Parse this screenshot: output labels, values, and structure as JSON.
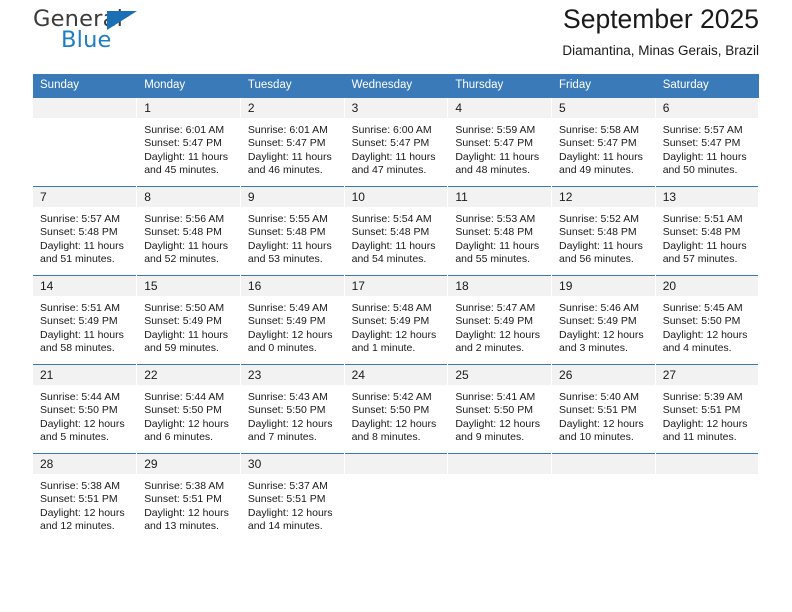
{
  "logo": {
    "word_top": "General",
    "word_bottom": "Blue",
    "triangle": "triangle-icon",
    "color_blue": "#1c7fc4",
    "color_dark": "#3c3c3c"
  },
  "header": {
    "title": "September 2025",
    "subtitle": "Diamantina, Minas Gerais, Brazil",
    "accent_color": "#3a7ab8"
  },
  "weekday_headers": [
    "Sunday",
    "Monday",
    "Tuesday",
    "Wednesday",
    "Thursday",
    "Friday",
    "Saturday"
  ],
  "weeks": [
    [
      {
        "day": "",
        "lines": []
      },
      {
        "day": "1",
        "lines": [
          "Sunrise: 6:01 AM",
          "Sunset: 5:47 PM",
          "Daylight: 11 hours",
          "and 45 minutes."
        ]
      },
      {
        "day": "2",
        "lines": [
          "Sunrise: 6:01 AM",
          "Sunset: 5:47 PM",
          "Daylight: 11 hours",
          "and 46 minutes."
        ]
      },
      {
        "day": "3",
        "lines": [
          "Sunrise: 6:00 AM",
          "Sunset: 5:47 PM",
          "Daylight: 11 hours",
          "and 47 minutes."
        ]
      },
      {
        "day": "4",
        "lines": [
          "Sunrise: 5:59 AM",
          "Sunset: 5:47 PM",
          "Daylight: 11 hours",
          "and 48 minutes."
        ]
      },
      {
        "day": "5",
        "lines": [
          "Sunrise: 5:58 AM",
          "Sunset: 5:47 PM",
          "Daylight: 11 hours",
          "and 49 minutes."
        ]
      },
      {
        "day": "6",
        "lines": [
          "Sunrise: 5:57 AM",
          "Sunset: 5:47 PM",
          "Daylight: 11 hours",
          "and 50 minutes."
        ]
      }
    ],
    [
      {
        "day": "7",
        "lines": [
          "Sunrise: 5:57 AM",
          "Sunset: 5:48 PM",
          "Daylight: 11 hours",
          "and 51 minutes."
        ]
      },
      {
        "day": "8",
        "lines": [
          "Sunrise: 5:56 AM",
          "Sunset: 5:48 PM",
          "Daylight: 11 hours",
          "and 52 minutes."
        ]
      },
      {
        "day": "9",
        "lines": [
          "Sunrise: 5:55 AM",
          "Sunset: 5:48 PM",
          "Daylight: 11 hours",
          "and 53 minutes."
        ]
      },
      {
        "day": "10",
        "lines": [
          "Sunrise: 5:54 AM",
          "Sunset: 5:48 PM",
          "Daylight: 11 hours",
          "and 54 minutes."
        ]
      },
      {
        "day": "11",
        "lines": [
          "Sunrise: 5:53 AM",
          "Sunset: 5:48 PM",
          "Daylight: 11 hours",
          "and 55 minutes."
        ]
      },
      {
        "day": "12",
        "lines": [
          "Sunrise: 5:52 AM",
          "Sunset: 5:48 PM",
          "Daylight: 11 hours",
          "and 56 minutes."
        ]
      },
      {
        "day": "13",
        "lines": [
          "Sunrise: 5:51 AM",
          "Sunset: 5:48 PM",
          "Daylight: 11 hours",
          "and 57 minutes."
        ]
      }
    ],
    [
      {
        "day": "14",
        "lines": [
          "Sunrise: 5:51 AM",
          "Sunset: 5:49 PM",
          "Daylight: 11 hours",
          "and 58 minutes."
        ]
      },
      {
        "day": "15",
        "lines": [
          "Sunrise: 5:50 AM",
          "Sunset: 5:49 PM",
          "Daylight: 11 hours",
          "and 59 minutes."
        ]
      },
      {
        "day": "16",
        "lines": [
          "Sunrise: 5:49 AM",
          "Sunset: 5:49 PM",
          "Daylight: 12 hours",
          "and 0 minutes."
        ]
      },
      {
        "day": "17",
        "lines": [
          "Sunrise: 5:48 AM",
          "Sunset: 5:49 PM",
          "Daylight: 12 hours",
          "and 1 minute."
        ]
      },
      {
        "day": "18",
        "lines": [
          "Sunrise: 5:47 AM",
          "Sunset: 5:49 PM",
          "Daylight: 12 hours",
          "and 2 minutes."
        ]
      },
      {
        "day": "19",
        "lines": [
          "Sunrise: 5:46 AM",
          "Sunset: 5:49 PM",
          "Daylight: 12 hours",
          "and 3 minutes."
        ]
      },
      {
        "day": "20",
        "lines": [
          "Sunrise: 5:45 AM",
          "Sunset: 5:50 PM",
          "Daylight: 12 hours",
          "and 4 minutes."
        ]
      }
    ],
    [
      {
        "day": "21",
        "lines": [
          "Sunrise: 5:44 AM",
          "Sunset: 5:50 PM",
          "Daylight: 12 hours",
          "and 5 minutes."
        ]
      },
      {
        "day": "22",
        "lines": [
          "Sunrise: 5:44 AM",
          "Sunset: 5:50 PM",
          "Daylight: 12 hours",
          "and 6 minutes."
        ]
      },
      {
        "day": "23",
        "lines": [
          "Sunrise: 5:43 AM",
          "Sunset: 5:50 PM",
          "Daylight: 12 hours",
          "and 7 minutes."
        ]
      },
      {
        "day": "24",
        "lines": [
          "Sunrise: 5:42 AM",
          "Sunset: 5:50 PM",
          "Daylight: 12 hours",
          "and 8 minutes."
        ]
      },
      {
        "day": "25",
        "lines": [
          "Sunrise: 5:41 AM",
          "Sunset: 5:50 PM",
          "Daylight: 12 hours",
          "and 9 minutes."
        ]
      },
      {
        "day": "26",
        "lines": [
          "Sunrise: 5:40 AM",
          "Sunset: 5:51 PM",
          "Daylight: 12 hours",
          "and 10 minutes."
        ]
      },
      {
        "day": "27",
        "lines": [
          "Sunrise: 5:39 AM",
          "Sunset: 5:51 PM",
          "Daylight: 12 hours",
          "and 11 minutes."
        ]
      }
    ],
    [
      {
        "day": "28",
        "lines": [
          "Sunrise: 5:38 AM",
          "Sunset: 5:51 PM",
          "Daylight: 12 hours",
          "and 12 minutes."
        ]
      },
      {
        "day": "29",
        "lines": [
          "Sunrise: 5:38 AM",
          "Sunset: 5:51 PM",
          "Daylight: 12 hours",
          "and 13 minutes."
        ]
      },
      {
        "day": "30",
        "lines": [
          "Sunrise: 5:37 AM",
          "Sunset: 5:51 PM",
          "Daylight: 12 hours",
          "and 14 minutes."
        ]
      },
      {
        "day": "",
        "lines": []
      },
      {
        "day": "",
        "lines": []
      },
      {
        "day": "",
        "lines": []
      },
      {
        "day": "",
        "lines": []
      }
    ]
  ]
}
